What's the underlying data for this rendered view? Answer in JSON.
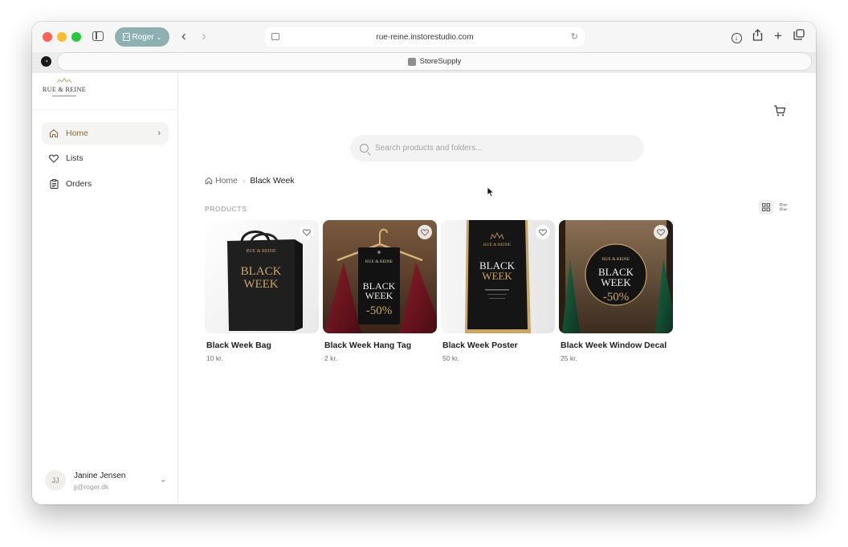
{
  "browser": {
    "profile_label": "Roger",
    "url": "rue-reine.instorestudio.com",
    "tab_title": "StoreSupply"
  },
  "sidebar": {
    "logo_text": "RUE & REINE",
    "nav": [
      {
        "label": "Home",
        "active": true
      },
      {
        "label": "Lists",
        "active": false
      },
      {
        "label": "Orders",
        "active": false
      }
    ],
    "user": {
      "initials": "JJ",
      "name": "Janine Jensen",
      "email": "jj@roger.dk"
    }
  },
  "main": {
    "search_placeholder": "Search products and folders...",
    "breadcrumb": {
      "home": "Home",
      "current": "Black Week"
    },
    "section_label": "PRODUCTS",
    "products": [
      {
        "name": "Black Week Bag",
        "price": "10 kr."
      },
      {
        "name": "Black Week Hang Tag",
        "price": "2 kr."
      },
      {
        "name": "Black Week Poster",
        "price": "50 kr."
      },
      {
        "name": "Black Week Window Decal",
        "price": "25 kr."
      }
    ]
  },
  "product_images": {
    "bag": {
      "brand": "RUE & REINE",
      "line1": "BLACK",
      "line2": "WEEK"
    },
    "tag": {
      "brand": "RUE & REINE",
      "line1": "BLACK",
      "line2": "WEEK",
      "discount": "-50%"
    },
    "poster": {
      "brand": "RUE & REINE",
      "line1": "BLACK",
      "line2": "WEEK"
    },
    "decal": {
      "brand": "RUE & REINE",
      "line1": "BLACK",
      "line2": "WEEK",
      "discount": "-50%"
    }
  },
  "colors": {
    "accent": "#8a6a3c",
    "profile_pill": "#8fb0b1",
    "gold": "#c9a566"
  }
}
